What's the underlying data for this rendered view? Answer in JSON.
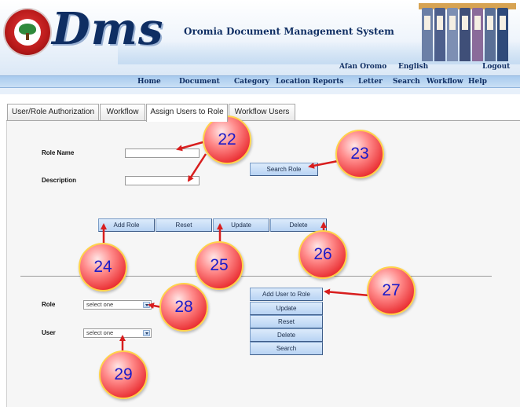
{
  "header": {
    "brand": "Dms",
    "system_title": "Oromia Document Management System",
    "links": {
      "afan_oromo": "Afan Oromo",
      "english": "English",
      "logout": "Logout"
    },
    "binder_colors": [
      "#6b7fa6",
      "#4d5f8c",
      "#7d8fb3",
      "#3f4f78",
      "#8a6b9a",
      "#5a6f96",
      "#2f4a7a"
    ]
  },
  "nav": {
    "home": "Home",
    "document": "Document",
    "category": "Category",
    "location": "Location",
    "reports": "Reports",
    "letter": "Letter",
    "search": "Search",
    "workflow": "Workflow",
    "help": "Help"
  },
  "tabs": {
    "user_role_authorization": "User/Role Authorization",
    "workflow": "Workflow",
    "assign_users_to_role": "Assign Users to Role",
    "workflow_users": "Workflow Users"
  },
  "role_form": {
    "role_name_label": "Role Name",
    "role_name_value": "",
    "description_label": "Description",
    "description_value": "",
    "search_role": "Search Role",
    "add_role": "Add Role",
    "reset": "Reset",
    "update": "Update",
    "delete": "Delete"
  },
  "assign_form": {
    "role_label": "Role",
    "role_select": "select one",
    "user_label": "User",
    "user_select": "select one",
    "add_user_to_role": "Add User to Role",
    "update": "Update",
    "reset": "Reset",
    "delete": "Delete",
    "search": "Search"
  },
  "callouts": [
    "22",
    "23",
    "24",
    "25",
    "26",
    "27",
    "28",
    "29"
  ],
  "colors": {
    "callout_red": "#e8282c",
    "callout_number": "#1a1ac8",
    "button_blue": "#b8d3f3",
    "nav_blue": "#a9cbee",
    "title_navy": "#0f2e63"
  }
}
